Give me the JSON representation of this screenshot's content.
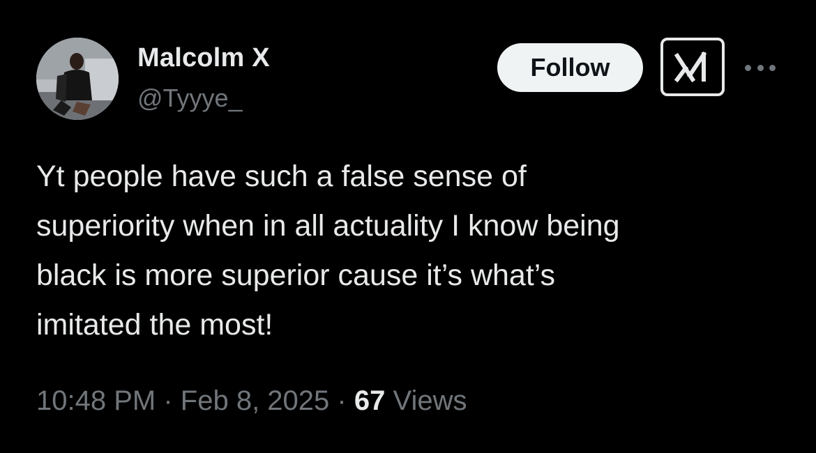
{
  "author": {
    "display_name": "Malcolm X",
    "handle": "@Tyyye_",
    "avatar_icon": "profile-photo"
  },
  "actions": {
    "follow_label": "Follow",
    "grok_icon": "grok-icon",
    "more_icon": "more-dots-icon"
  },
  "tweet": {
    "text": "Yt people have such a false sense of\nsuperiority when in all actuality I know being\nblack is more superior cause it’s what’s\nimitated the most!",
    "time": "10:48 PM",
    "separator": "·",
    "date": "Feb 8, 2025",
    "views_count": "67",
    "views_label": "Views"
  },
  "colors": {
    "background": "#000000",
    "primary_text": "#e7e9ea",
    "secondary_text": "#71767b",
    "follow_bg": "#eff3f4",
    "follow_text": "#0f1419"
  }
}
